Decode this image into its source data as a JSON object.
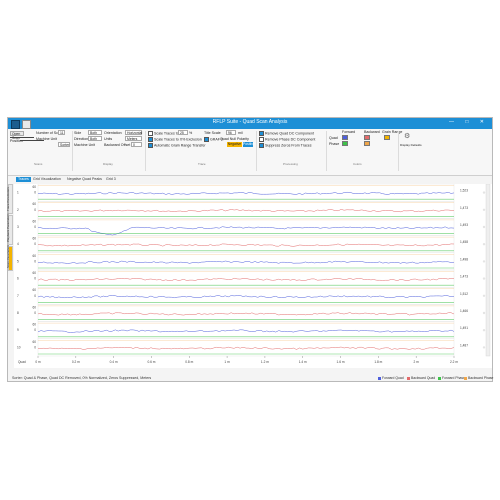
{
  "titlebar": {
    "title": "RFLP Suite - Quad Scan Analysis",
    "controls": "— □ ✕"
  },
  "ribbon": {
    "open_scan": "Open Scan",
    "position_label": "Position",
    "num_scans_label": "Number of Scans",
    "num_scans_value": "11",
    "side_label": "Side",
    "side_value": "Both",
    "direction_label": "Direction",
    "direction_value": "Both",
    "machine_unit_label": "Machine Unit",
    "machine_unit_value": "Sorter",
    "orientation_label": "Orientation",
    "orientation_value": "Horizontal",
    "units_label": "Units",
    "units_value": "Meters",
    "backward_offset_label": "Backward Offset",
    "backward_offset_value": "0",
    "scale_traces_label": "Scale Traces to",
    "scale_traces_value": "25",
    "scale_traces_unit": "%",
    "scale_x_axis_label": "Scale Traces to X% Exclusion",
    "auto_scale_label": "Automatic Grain Range Transfer",
    "title_scale_label": "Title Scale",
    "title_scale_value": "96",
    "title_scale_unit": "mil",
    "grain_x_label": "GRAF X",
    "quad_null_label": "Quad Null Polarity",
    "negative_btn": "Negative",
    "polarity_btn": "Positive",
    "remove_quad_dc": "Remove Quad DC Component",
    "remove_phase_dc": "Remove Phase DC Component",
    "suppress_zeros": "Suppress Zeros From Traces",
    "forward_label": "Forward",
    "backward_label": "Backward",
    "quad_label": "Quad",
    "phase_label": "Phase",
    "grain_range_label": "Grain Range",
    "display_defaults_label": "Display Defaults",
    "group_labels": [
      "Scans",
      "Display",
      "Trace",
      "Processing",
      "Filters",
      "Colors"
    ]
  },
  "tabs": [
    {
      "label": "Traces",
      "active": true
    },
    {
      "label": "Grid Visualization",
      "active": false
    },
    {
      "label": "Negative Quad Peaks",
      "active": false
    },
    {
      "label": "Grid 3",
      "active": false
    }
  ],
  "sidetabs": [
    "Trace Parameters",
    "Playback Parameters",
    "Scan Parameters"
  ],
  "chart_data": {
    "type": "line",
    "xlabel": "",
    "x_ticks": [
      "0 m",
      "0.2 m",
      "0.4 m",
      "0.6 m",
      "0.8 m",
      "1 m",
      "1.2 m",
      "1.4 m",
      "1.6 m",
      "1.8 m",
      "2 m",
      "2.2 m"
    ],
    "x_start_label": "Quad",
    "rows": [
      {
        "label": "1",
        "ytop": "60",
        "ymid": "0",
        "right_value": "1,523"
      },
      {
        "label": "2",
        "ytop": "60",
        "ymid": "0",
        "right_value": "1,473"
      },
      {
        "label": "3",
        "ytop": "60",
        "ymid": "0",
        "right_value": "1,493"
      },
      {
        "label": "4",
        "ytop": "60",
        "ymid": "0",
        "right_value": "1,458"
      },
      {
        "label": "5",
        "ytop": "60",
        "ymid": "0",
        "right_value": "1,498"
      },
      {
        "label": "6",
        "ytop": "60",
        "ymid": "0",
        "right_value": "1,473"
      },
      {
        "label": "7",
        "ytop": "60",
        "ymid": "0",
        "right_value": "1,512"
      },
      {
        "label": "8",
        "ytop": "60",
        "ymid": "0",
        "right_value": "1,466"
      },
      {
        "label": "9",
        "ytop": "60",
        "ymid": "0",
        "right_value": "1,491"
      },
      {
        "label": "10",
        "ytop": "60",
        "ymid": "0",
        "right_value": "1,487"
      }
    ],
    "series": [
      {
        "name": "Forward Quad",
        "color": "#4e5fdc"
      },
      {
        "name": "Backward Quad",
        "color": "#e36a6a"
      },
      {
        "name": "Forward Phase",
        "color": "#3ec24a"
      },
      {
        "name": "Backward Phase",
        "color": "#f0a64a"
      }
    ],
    "grid": true,
    "legend_position": "bottom-right"
  },
  "status": {
    "text": "Sorter: Quad & Phase, Quad DC Removed, 0% Normalized, Zeros Suppressed, Meters"
  },
  "colors": {
    "accent": "#1d8fd6",
    "warning": "#f4b400"
  }
}
